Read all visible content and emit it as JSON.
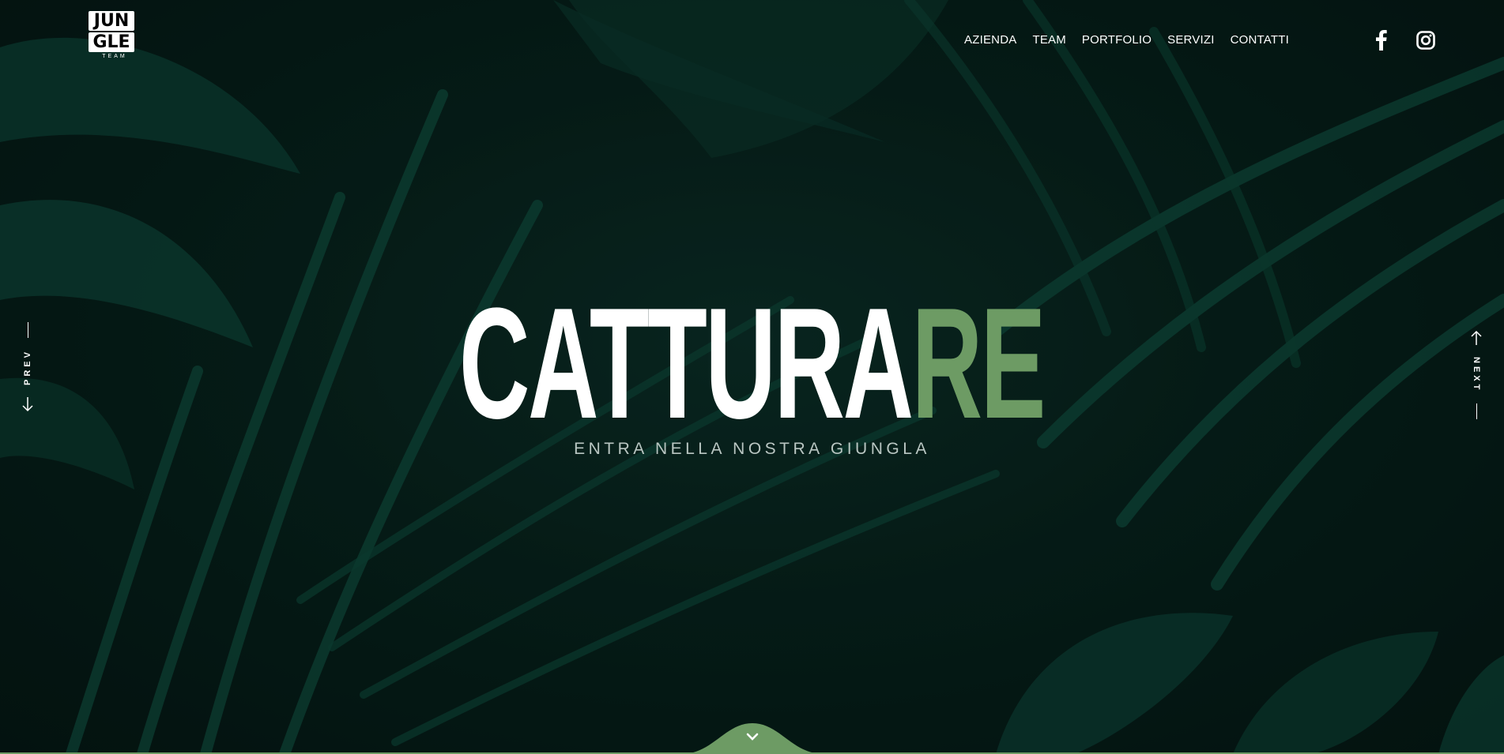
{
  "logo": {
    "lines": [
      "JUN",
      "GLE"
    ],
    "sub": "TEAM"
  },
  "nav": {
    "items": [
      "AZIENDA",
      "TEAM",
      "PORTFOLIO",
      "SERVIZI",
      "CONTATTI"
    ]
  },
  "social": {
    "icons": [
      "facebook-icon",
      "instagram-icon"
    ]
  },
  "hero": {
    "title_white": "CATTURA",
    "title_green": "RE",
    "subtitle": "ENTRA NELLA NOSTRA GIUNGLA"
  },
  "slider": {
    "prev_label": "PREV",
    "next_label": "NEXT"
  },
  "colors": {
    "accent": "#6d9b64",
    "background": "#04140f",
    "text": "#ffffff"
  }
}
